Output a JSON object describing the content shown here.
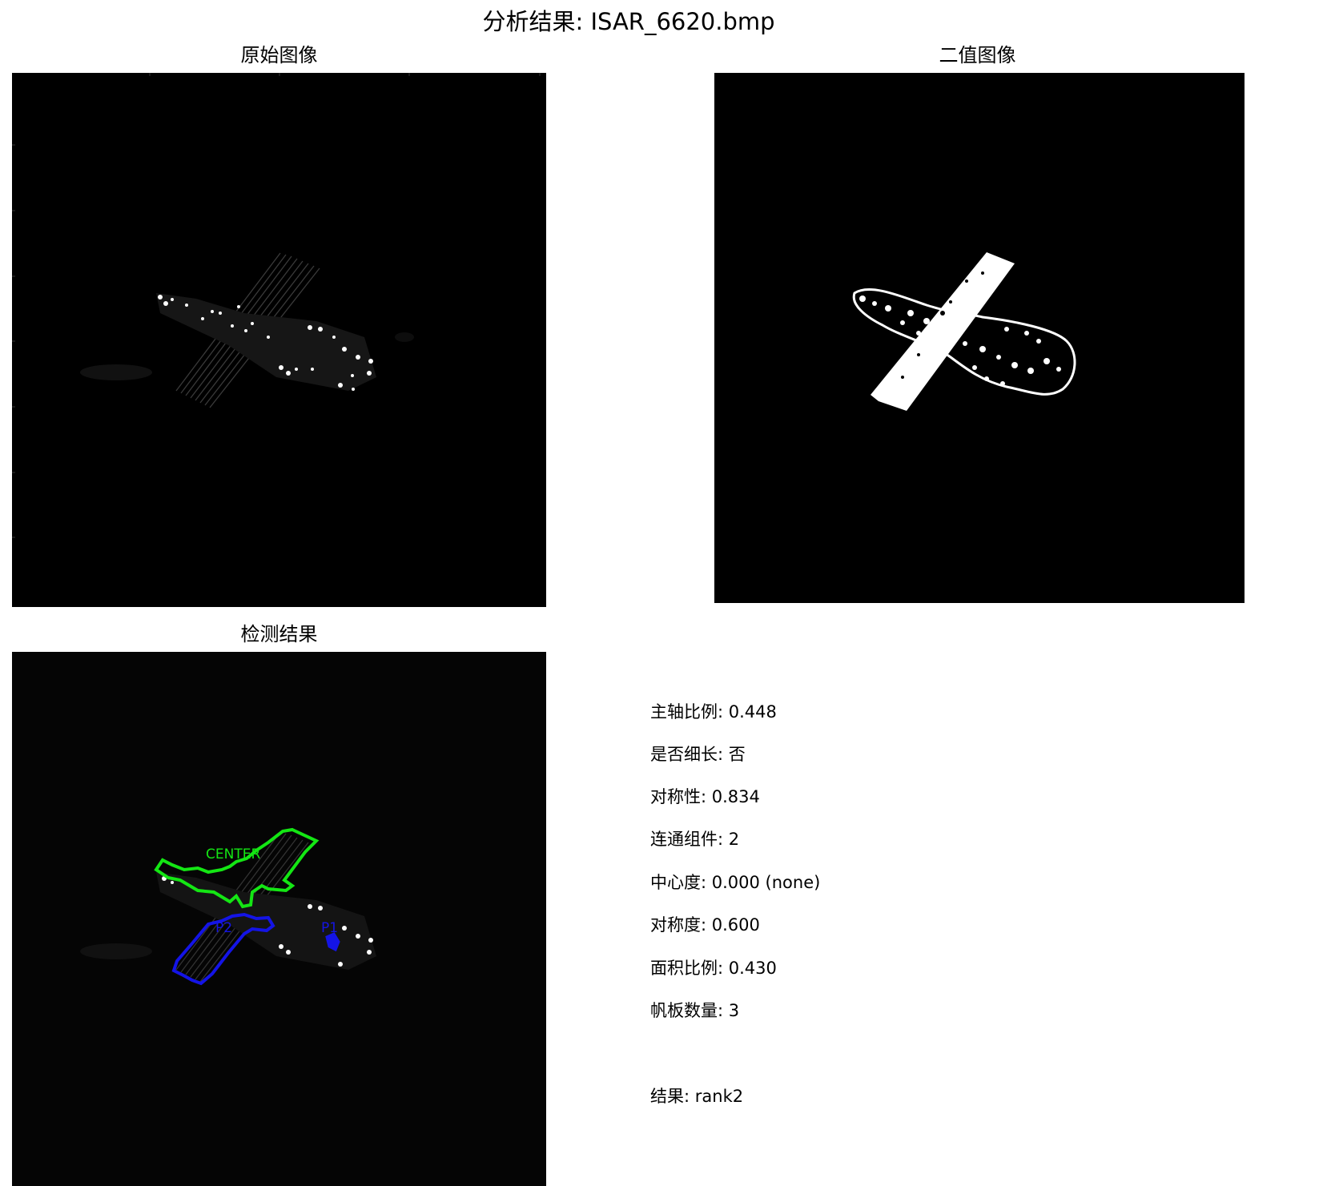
{
  "title": {
    "prefix": "分析结果",
    "sep": ": ",
    "filename": "ISAR_6620.bmp"
  },
  "panels": {
    "original": {
      "title": "原始图像"
    },
    "binary": {
      "title": "二值图像"
    },
    "result": {
      "title": "检测结果",
      "labels": {
        "center": "CENTER",
        "p1": "P1",
        "p2": "P2"
      }
    }
  },
  "info": {
    "lines": [
      {
        "label": "主轴比例",
        "value": "0.448"
      },
      {
        "label": "是否细长",
        "value": "否"
      },
      {
        "label": "对称性",
        "value": "0.834"
      },
      {
        "label": "连通组件",
        "value": "2"
      },
      {
        "label": "中心度",
        "value": "0.000 (none)"
      },
      {
        "label": "对称度",
        "value": "0.600"
      },
      {
        "label": "面积比例",
        "value": "0.430"
      },
      {
        "label": "帆板数量",
        "value": "3"
      }
    ],
    "result": {
      "label": "结果",
      "value": "rank2"
    }
  },
  "colors": {
    "background": "#ffffff",
    "image_bg": "#000000",
    "center_outline": "#14e614",
    "panel_outline": "#1414e6"
  }
}
